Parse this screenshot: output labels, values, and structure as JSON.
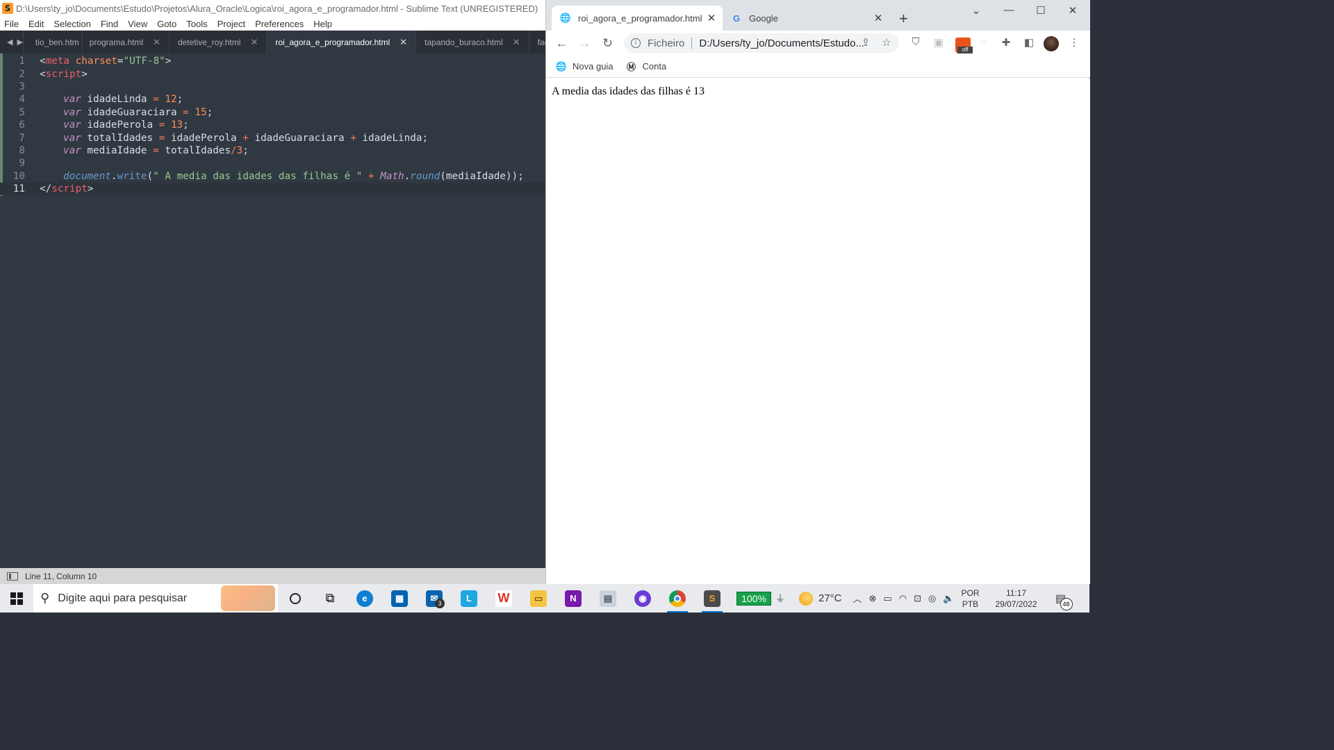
{
  "sublime": {
    "title": "D:\\Users\\ty_jo\\Documents\\Estudo\\Projetos\\Alura_Oracle\\Logica\\roi_agora_e_programador.html - Sublime Text (UNREGISTERED)",
    "menu": [
      "File",
      "Edit",
      "Selection",
      "Find",
      "View",
      "Goto",
      "Tools",
      "Project",
      "Preferences",
      "Help"
    ],
    "tabs": [
      "tio_ben.htm",
      "programa.html",
      "detetive_roy.html",
      "roi_agora_e_programador.html",
      "tapando_buraco.html",
      "facilitando_"
    ],
    "active_tab": "roi_agora_e_programador.html",
    "line_numbers": [
      "1",
      "2",
      "3",
      "4",
      "5",
      "6",
      "7",
      "8",
      "9",
      "10",
      "11"
    ],
    "code": {
      "l1": {
        "open": "<",
        "tag": "meta",
        "attr": " charset",
        "eq": "=",
        "val": "\"UTF-8\"",
        "close": ">"
      },
      "l2": {
        "open": "<",
        "tag": "script",
        "close": ">"
      },
      "l4": {
        "kw": "var",
        "name": " idadeLinda ",
        "op": "=",
        "num": " 12",
        "end": ";"
      },
      "l5": {
        "kw": "var",
        "name": " idadeGuaraciara ",
        "op": "=",
        "num": " 15",
        "end": ";"
      },
      "l6": {
        "kw": "var",
        "name": " idadePerola ",
        "op": "=",
        "num": " 13",
        "end": ";"
      },
      "l7": {
        "kw": "var",
        "name": " totalIdades ",
        "op": "=",
        "a": " idadePerola ",
        "op2": "+",
        "b": " idadeGuaraciara ",
        "op3": "+",
        "c": " idadeLinda",
        "end": ";"
      },
      "l8": {
        "kw": "var",
        "name": " mediaIdade ",
        "op": "=",
        "a": " totalIdades",
        "op2": "/",
        "num": "3",
        "end": ";"
      },
      "l10": {
        "obj": "document",
        "dot": ".",
        "fn": "write",
        "p1": "(",
        "str": "\" A media das idades das filhas é \"",
        "op": " + ",
        "cls": "Math",
        "dot2": ".",
        "fn2": "round",
        "p2": "(",
        "arg": "mediaIdade",
        "end": "));"
      },
      "l11": {
        "open": "</",
        "tag": "script",
        "close": ">"
      }
    },
    "status": "Line 11, Column 10"
  },
  "chrome": {
    "tabs": [
      {
        "label": "roi_agora_e_programador.html",
        "icon": "globe-icon"
      },
      {
        "label": "Google",
        "icon": "google-icon"
      }
    ],
    "omnibox": {
      "scheme": "Ficheiro",
      "url": "D:/Users/ty_jo/Documents/Estudo..."
    },
    "bookmarks": [
      {
        "label": "Nova guia",
        "icon": "globe-icon"
      },
      {
        "label": "Conta",
        "icon": "account-icon"
      }
    ],
    "page_text": "A media das idades das filhas é 13"
  },
  "taskbar": {
    "search_placeholder": "Digite aqui para pesquisar",
    "mail_badge": "3",
    "battery": "100%",
    "temperature": "27°C",
    "lang_top": "POR",
    "lang_bottom": "PTB",
    "time": "11:17",
    "date": "29/07/2022",
    "notification_count": "48"
  },
  "colors": {
    "editor_bg": "#303841",
    "tag": "#ec5f67",
    "string": "#99c794",
    "keyword": "#c594c5",
    "number": "#f99157",
    "function": "#6699cc"
  }
}
